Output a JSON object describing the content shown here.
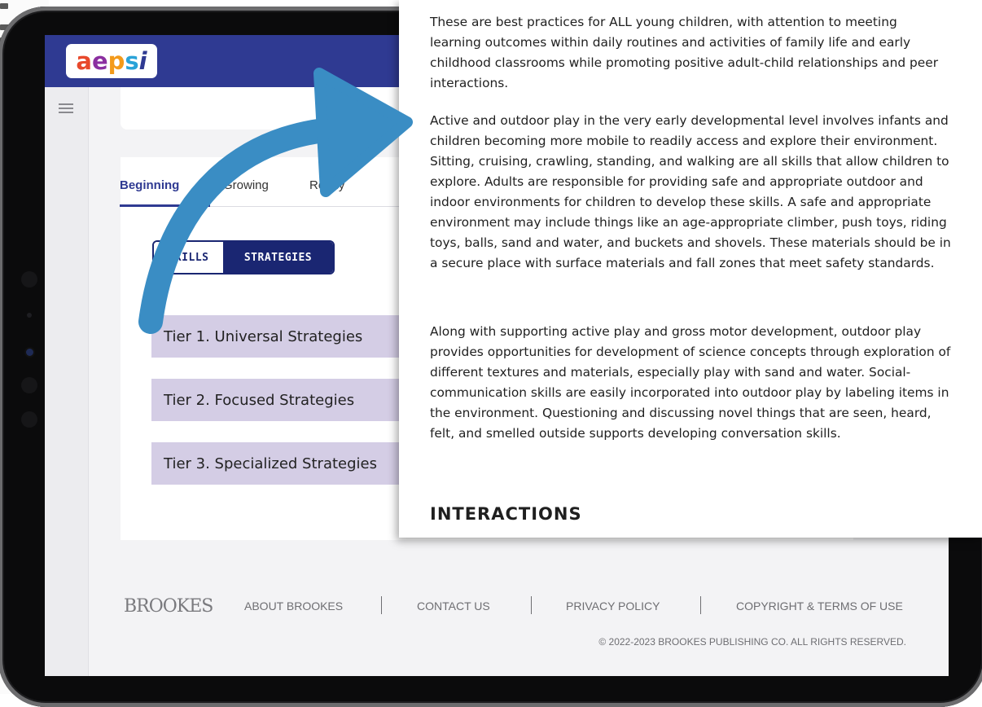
{
  "app": {
    "logo_letters": [
      "a",
      "e",
      "p",
      "s",
      "i"
    ],
    "logo_colors": [
      "#e8492c",
      "#8b2fa0",
      "#f39a1a",
      "#2aa3d8",
      "#2f3a92"
    ]
  },
  "tabs": [
    {
      "label": "Beginning",
      "active": true
    },
    {
      "label": "Growing",
      "active": false
    },
    {
      "label": "Ready",
      "active": false
    }
  ],
  "toggle": {
    "skills_label": "SKILLS",
    "strategies_label": "STRATEGIES",
    "selected": "STRATEGIES"
  },
  "tiers": [
    {
      "label": "Tier 1. Universal Strategies"
    },
    {
      "label": "Tier 2. Focused Strategies"
    },
    {
      "label": "Tier 3. Specialized Strategies"
    }
  ],
  "footer": {
    "logo": "BROOKES",
    "links": [
      "ABOUT BROOKES",
      "CONTACT US",
      "PRIVACY POLICY",
      "COPYRIGHT & TERMS OF USE"
    ],
    "copyright": "© 2022-2023 BROOKES PUBLISHING CO. ALL RIGHTS RESERVED."
  },
  "panel": {
    "paragraphs": [
      "These are best practices for ALL young children, with attention to meeting learning outcomes within daily routines and activities of family life and early childhood classrooms while promoting positive adult-child relationships and peer interactions.",
      "Active and outdoor play in the very early developmental level involves infants and children becoming more mobile to readily access and explore their environment. Sitting, cruising, crawling, standing, and walking are all skills that allow children to explore. Adults are responsible for providing safe and appropriate outdoor and indoor environments for children to develop these skills. A safe and appropriate environment may include things like an age-appropriate climber, push toys, riding toys, balls, sand and water, and buckets and shovels. These materials should be in a secure place with surface materials and fall zones that meet safety standards.",
      "Along with supporting active play and gross motor development, outdoor play provides opportunities for development of science concepts through exploration of different textures and materials, especially play with sand and water. Social-communication skills are easily incorporated into outdoor play by labeling items in the environment. Questioning and discussing novel things that are seen, heard, felt, and smelled outside supports developing conversation skills."
    ],
    "heading": "INTERACTIONS"
  },
  "colors": {
    "header_bg": "#2f3a92",
    "toggle_dark": "#1a2672",
    "tier_bg": "#d4cde5",
    "arrow": "#3a8dc4"
  }
}
